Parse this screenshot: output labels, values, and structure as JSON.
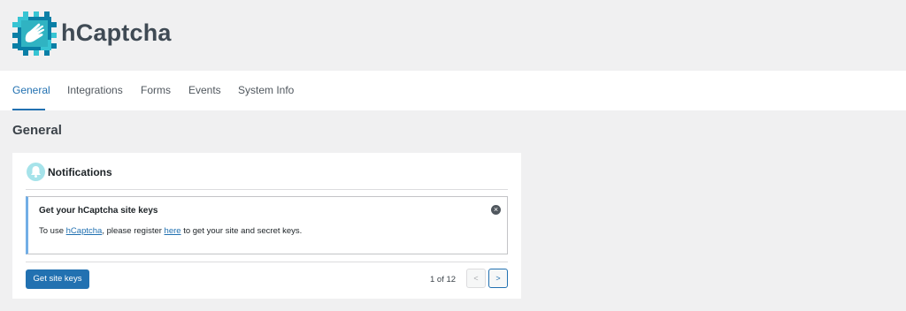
{
  "brand": {
    "name": "hCaptcha"
  },
  "tabs": [
    {
      "label": "General",
      "active": true
    },
    {
      "label": "Integrations"
    },
    {
      "label": "Forms"
    },
    {
      "label": "Events"
    },
    {
      "label": "System Info"
    }
  ],
  "page": {
    "title": "General"
  },
  "notifications": {
    "title": "Notifications",
    "notice": {
      "title": "Get your hCaptcha site keys",
      "text_before": "To use ",
      "link1": "hCaptcha",
      "text_middle": ", please register ",
      "link2": "here",
      "text_after": " to get your site and secret keys."
    },
    "button_label": "Get site keys",
    "pager": {
      "count": "1 of 12",
      "prev": "<",
      "next": ">"
    }
  },
  "colors": {
    "accent": "#2271b1",
    "notice_border": "#72aee6",
    "logo_teal": "#30b3c2"
  },
  "icons": {
    "logo": "hand-icon",
    "bell": "bell-icon",
    "close": "close-icon"
  }
}
